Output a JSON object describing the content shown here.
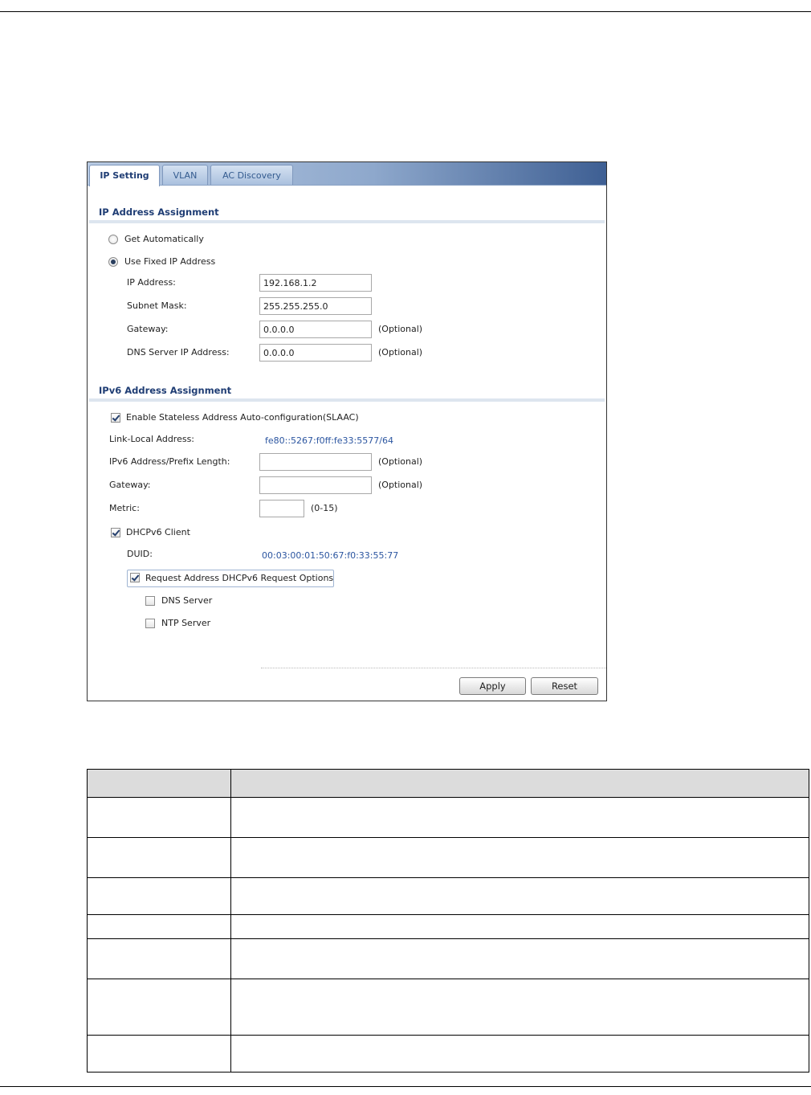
{
  "tabs": [
    {
      "label": "IP Setting",
      "active": true
    },
    {
      "label": "VLAN",
      "active": false
    },
    {
      "label": "AC Discovery",
      "active": false
    }
  ],
  "ipv4": {
    "section_title": "IP Address Assignment",
    "get_auto_label": "Get Automatically",
    "get_auto_selected": false,
    "fixed_label": "Use Fixed IP Address",
    "fixed_selected": true,
    "ip_label": "IP Address:",
    "ip_value": "192.168.1.2",
    "mask_label": "Subnet Mask:",
    "mask_value": "255.255.255.0",
    "gateway_label": "Gateway:",
    "gateway_value": "0.0.0.0",
    "dns_label": "DNS Server IP Address:",
    "dns_value": "0.0.0.0",
    "optional_note": "(Optional)"
  },
  "ipv6": {
    "section_title": "IPv6 Address Assignment",
    "slaac_label": "Enable Stateless Address Auto-configuration(SLAAC)",
    "slaac_checked": true,
    "link_local_label": "Link-Local Address:",
    "link_local_value": "fe80::5267:f0ff:fe33:5577/64",
    "prefix_label": "IPv6 Address/Prefix Length:",
    "prefix_value": "",
    "gateway_label": "Gateway:",
    "gateway_value": "",
    "optional_note": "(Optional)",
    "metric_label": "Metric:",
    "metric_value": "",
    "metric_range": "(0-15)",
    "dhcp_label": "DHCPv6 Client",
    "dhcp_checked": true,
    "duid_label": "DUID:",
    "duid_value": "00:03:00:01:50:67:f0:33:55:77",
    "request_label": "Request Address DHCPv6 Request Options",
    "request_checked": true,
    "dns_server_label": "DNS Server",
    "dns_server_checked": false,
    "ntp_server_label": "NTP Server",
    "ntp_server_checked": false
  },
  "buttons": {
    "apply": "Apply",
    "reset": "Reset"
  },
  "desc_table": {
    "row_count": 7
  }
}
